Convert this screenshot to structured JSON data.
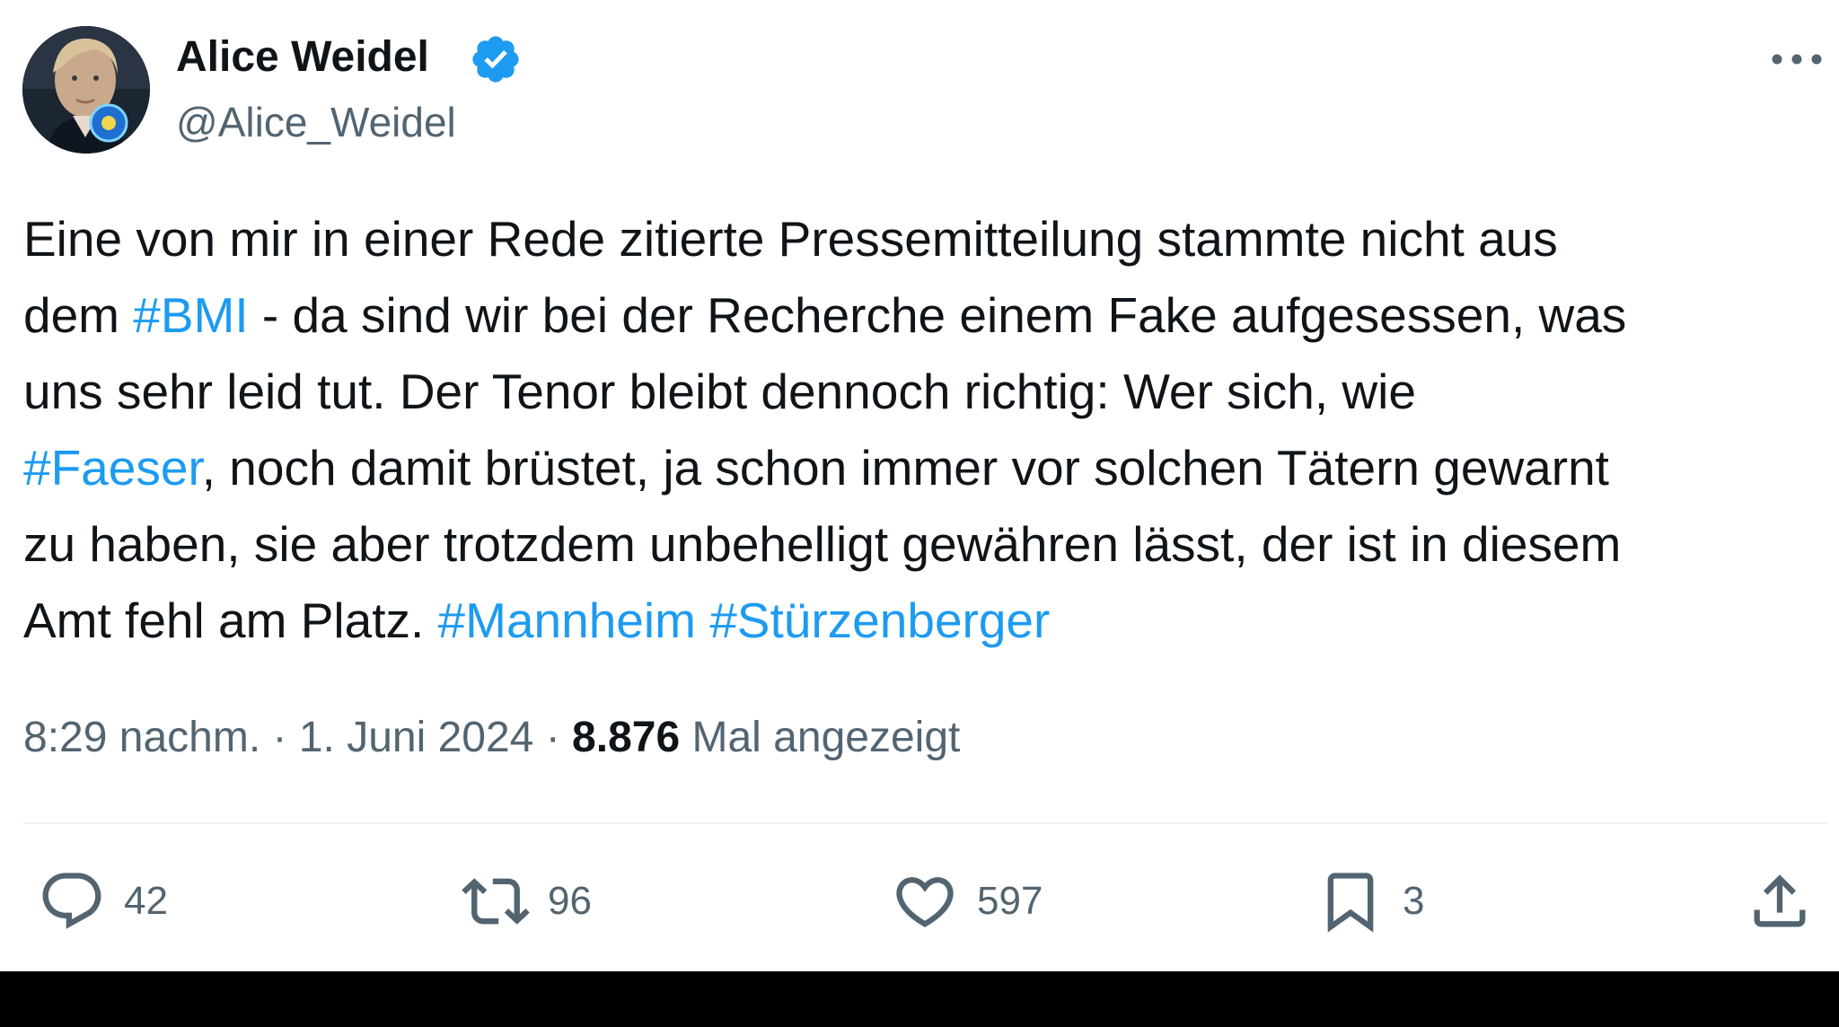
{
  "author": {
    "display_name": "Alice Weidel",
    "handle": "@Alice_Weidel",
    "verified": true,
    "verified_color": "#1d9bf0"
  },
  "tweet": {
    "lines": [
      [
        {
          "text": "Eine von mir in einer Rede zitierte Pressemitteilung stammte nicht aus",
          "hashtag": false
        }
      ],
      [
        {
          "text": "dem ",
          "hashtag": false
        },
        {
          "text": "#BMI",
          "hashtag": true
        },
        {
          "text": " - da sind wir bei der Recherche einem Fake aufgesessen, was",
          "hashtag": false
        }
      ],
      [
        {
          "text": "uns sehr leid tut. Der Tenor bleibt dennoch richtig: Wer sich, wie",
          "hashtag": false
        }
      ],
      [
        {
          "text": "#Faeser",
          "hashtag": true
        },
        {
          "text": ", noch damit brüstet, ja schon immer vor solchen Tätern gewarnt",
          "hashtag": false
        }
      ],
      [
        {
          "text": "zu haben, sie aber trotzdem unbehelligt gewähren lässt, der ist in diesem",
          "hashtag": false
        }
      ],
      [
        {
          "text": "Amt fehl am Platz. ",
          "hashtag": false
        },
        {
          "text": "#Mannheim",
          "hashtag": true
        },
        {
          "text": " ",
          "hashtag": false
        },
        {
          "text": "#Stürzenberger",
          "hashtag": true
        }
      ]
    ],
    "hashtag_color": "#1d9bf0"
  },
  "meta": {
    "time": "8:29 nachm.",
    "separator": " · ",
    "date": "1. Juni 2024",
    "views_count": "8.876",
    "views_label": " Mal angezeigt"
  },
  "actions": {
    "replies": {
      "icon": "reply-icon",
      "count": "42"
    },
    "retweets": {
      "icon": "retweet-icon",
      "count": "96"
    },
    "likes": {
      "icon": "heart-icon",
      "count": "597"
    },
    "bookmarks": {
      "icon": "bookmark-icon",
      "count": "3"
    },
    "share": {
      "icon": "share-icon"
    }
  },
  "colors": {
    "text_primary": "#0f1419",
    "text_secondary": "#536471",
    "divider": "#eff3f4"
  }
}
